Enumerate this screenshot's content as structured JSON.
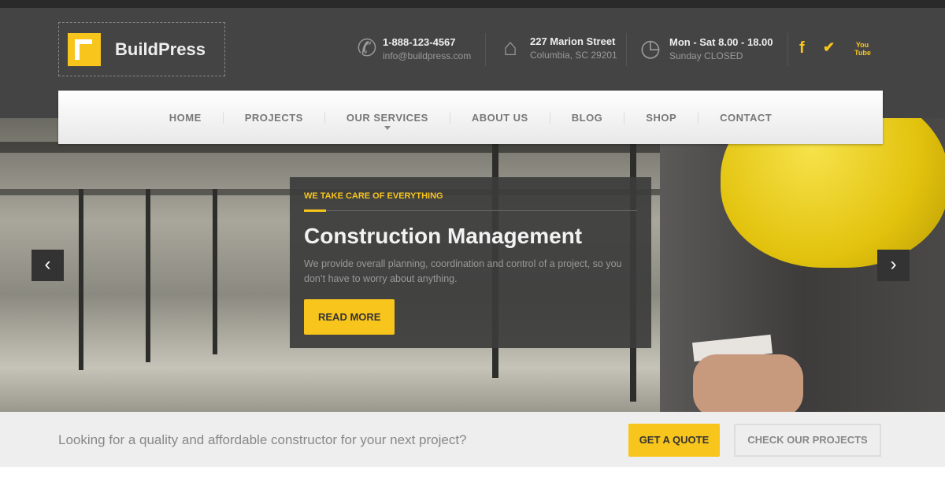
{
  "brand": {
    "name": "BuildPress",
    "accent": "#f8c51c"
  },
  "header": {
    "phone": {
      "icon": "phone-icon",
      "line1": "1-888-123-4567",
      "line2": "info@buildpress.com"
    },
    "address": {
      "icon": "home-icon",
      "line1": "227 Marion Street",
      "line2": "Columbia, SC 29201"
    },
    "hours": {
      "icon": "clock-icon",
      "line1": "Mon - Sat 8.00 - 18.00",
      "line2": "Sunday CLOSED"
    },
    "social": {
      "facebook": "f",
      "twitter": "🐦",
      "youtube": "You Tube"
    }
  },
  "nav": {
    "items": [
      "HOME",
      "PROJECTS",
      "OUR SERVICES",
      "ABOUT US",
      "BLOG",
      "SHOP",
      "CONTACT"
    ]
  },
  "hero": {
    "subtitle": "WE TAKE CARE OF EVERYTHING",
    "title": "Construction Management",
    "text": "We provide overall planning, coordination and control of a project, so you don’t have to worry about anything.",
    "button": "READ MORE",
    "prev": "‹",
    "next": "›"
  },
  "cta": {
    "text": "Looking for a quality and affordable constructor for your next project?",
    "quote": "GET A QUOTE",
    "projects": "CHECK OUR PROJECTS"
  }
}
